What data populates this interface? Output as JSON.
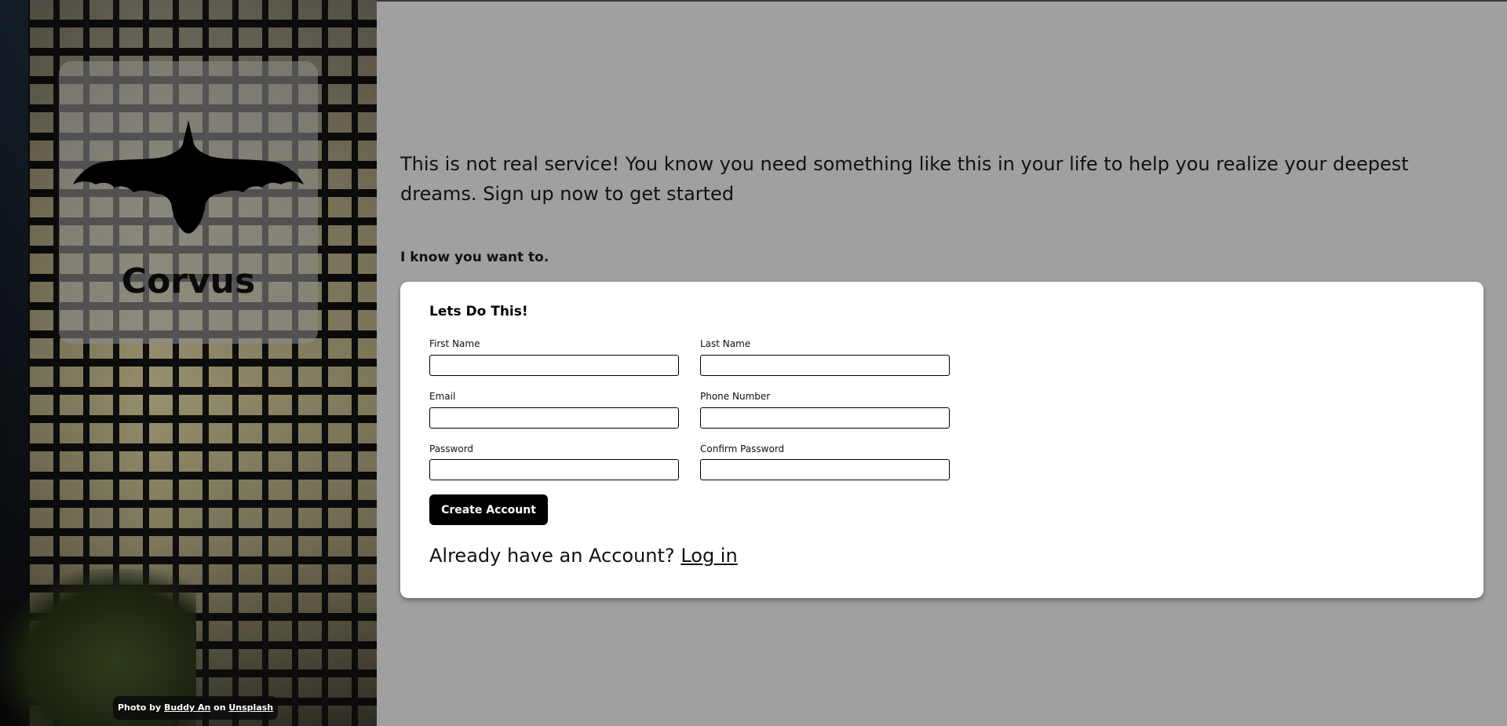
{
  "sidebar": {
    "brand_name": "Corvus",
    "credit": {
      "prefix": "Photo by",
      "author": "Buddy An",
      "middle": "on",
      "site": "Unsplash"
    }
  },
  "main": {
    "intro": "This is not real service! You know you need something like this in your life to help you realize your deepest dreams. Sign up now to get started",
    "tagline": "I know you want to."
  },
  "form": {
    "title": "Lets Do This!",
    "fields": {
      "first_name": {
        "label": "First Name",
        "value": ""
      },
      "last_name": {
        "label": "Last Name",
        "value": ""
      },
      "email": {
        "label": "Email",
        "value": ""
      },
      "phone": {
        "label": "Phone Number",
        "value": ""
      },
      "password": {
        "label": "Password",
        "value": ""
      },
      "confirm_password": {
        "label": "Confirm Password",
        "value": ""
      }
    },
    "submit_label": "Create Account",
    "login_prompt": "Already have an Account?",
    "login_link": "Log in"
  },
  "colors": {
    "page_bg": "#a0a0a0",
    "card_bg": "#ffffff",
    "button_bg": "#000000",
    "button_text": "#ffffff"
  },
  "icons": {
    "logo": "raven-icon"
  }
}
